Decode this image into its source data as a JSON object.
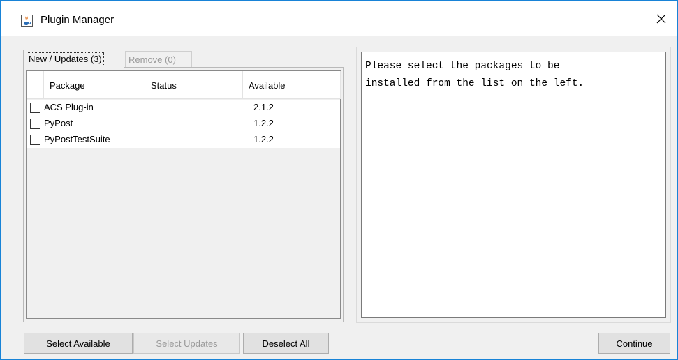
{
  "window": {
    "title": "Plugin Manager",
    "app_icon": "java-coffee-cup-icon",
    "close_icon": "close-icon"
  },
  "tabs": [
    {
      "label": "New / Updates (3)",
      "active": true,
      "enabled": true
    },
    {
      "label": "Remove (0)",
      "active": false,
      "enabled": false
    }
  ],
  "table": {
    "columns": [
      "Package",
      "Status",
      "Available"
    ],
    "rows": [
      {
        "checked": false,
        "package": "ACS Plug-in",
        "status": "",
        "available": "2.1.2"
      },
      {
        "checked": false,
        "package": "PyPost",
        "status": "",
        "available": "1.2.2"
      },
      {
        "checked": false,
        "package": "PyPostTestSuite",
        "status": "",
        "available": "1.2.2"
      }
    ]
  },
  "info": {
    "text": "Please select the packages to be\ninstalled from the list on the left."
  },
  "buttons": {
    "select_available": "Select Available",
    "select_updates": "Select Updates",
    "deselect_all": "Deselect All",
    "continue": "Continue"
  },
  "colors": {
    "window_border": "#1883d7",
    "background": "#f0f0f0",
    "disabled_text": "#9a9a9a"
  }
}
